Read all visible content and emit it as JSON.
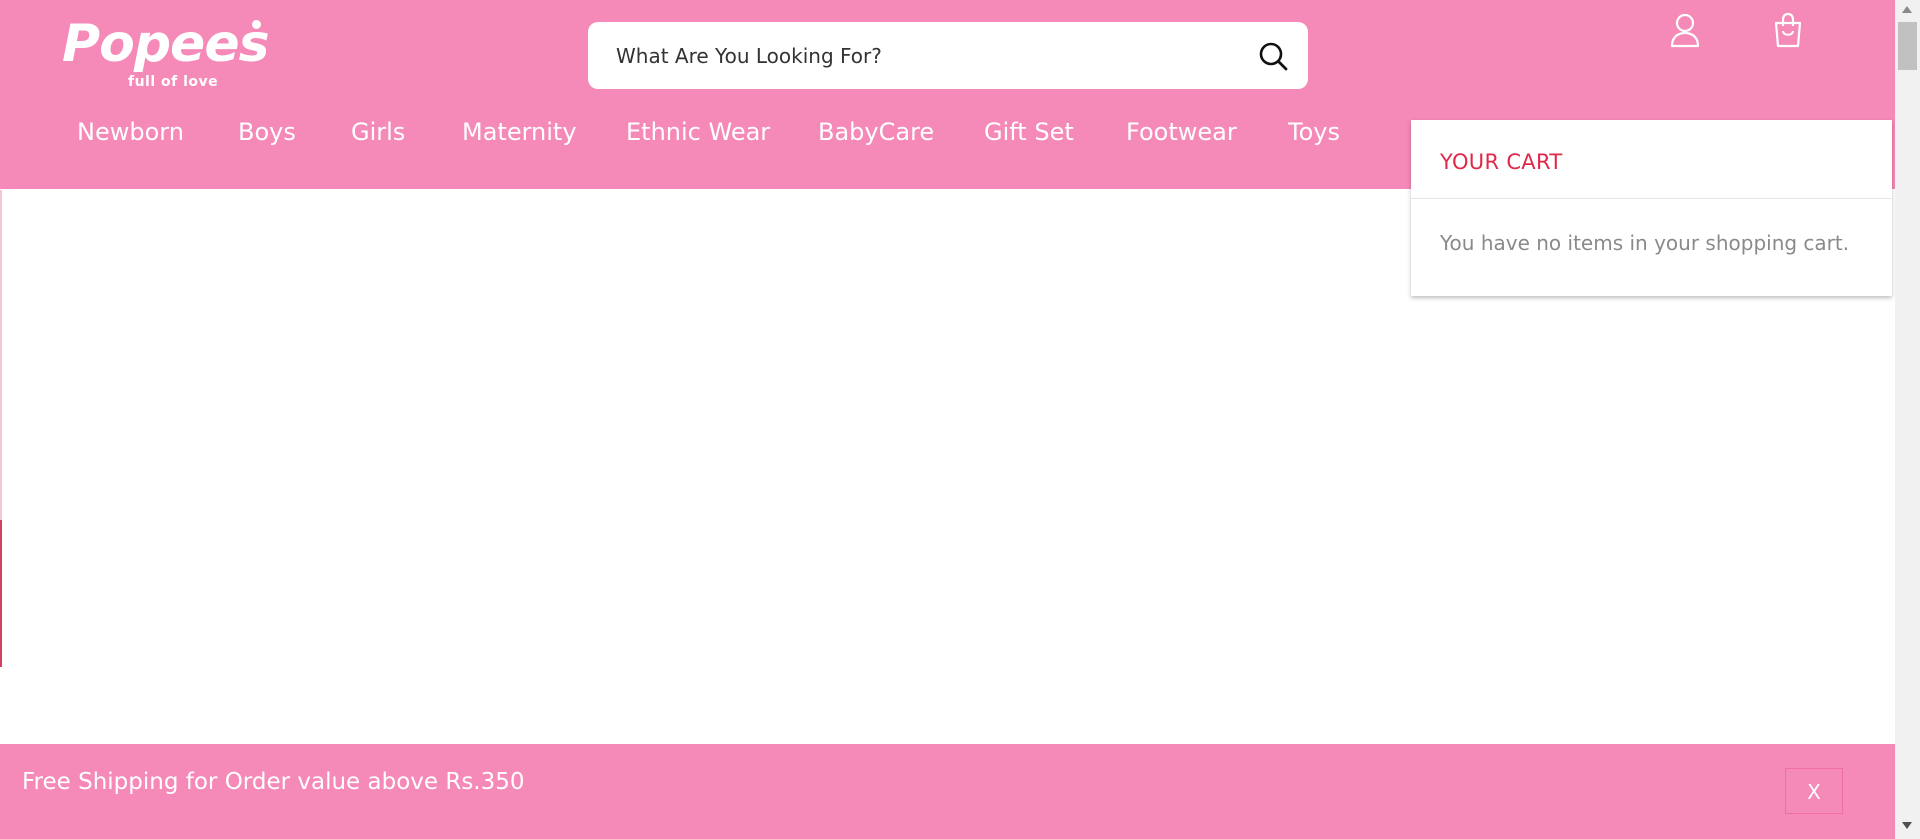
{
  "brand": {
    "logo_text": "Popees",
    "tagline": "full of love"
  },
  "search": {
    "placeholder": "What Are You Looking For?"
  },
  "header_icons": {
    "account": "user-icon",
    "cart": "shopping-bag-icon"
  },
  "nav": {
    "items": [
      {
        "label": "Newborn"
      },
      {
        "label": "Boys"
      },
      {
        "label": "Girls"
      },
      {
        "label": "Maternity"
      },
      {
        "label": "Ethnic Wear"
      },
      {
        "label": "BabyCare"
      },
      {
        "label": "Gift Set"
      },
      {
        "label": "Footwear"
      },
      {
        "label": "Toys"
      }
    ]
  },
  "cart": {
    "title": "YOUR CART",
    "empty_message": "You have no items in your shopping cart."
  },
  "promo": {
    "text": "Free Shipping for Order value above Rs.350",
    "close_label": "X"
  },
  "colors": {
    "header_pink": "#f589b7",
    "cart_title_red": "#e0284a",
    "muted_text": "#8a8a8a"
  }
}
